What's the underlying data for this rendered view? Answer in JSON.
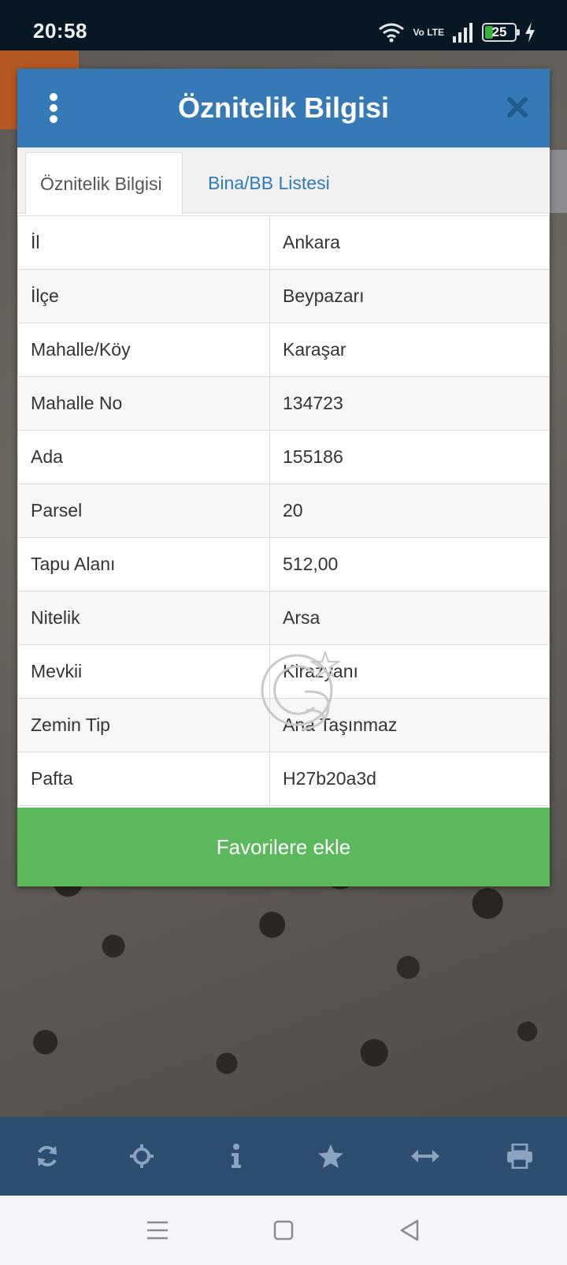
{
  "status_bar": {
    "time": "20:58",
    "battery_level": "25",
    "battery_fraction": 0.25,
    "network": "Vo LTE"
  },
  "modal": {
    "title": "Öznitelik Bilgisi",
    "tabs": [
      {
        "label": "Öznitelik Bilgisi",
        "active": true
      },
      {
        "label": "Bina/BB Listesi",
        "active": false
      }
    ],
    "rows": [
      {
        "key": "İl",
        "value": "Ankara"
      },
      {
        "key": "İlçe",
        "value": "Beypazarı"
      },
      {
        "key": "Mahalle/Köy",
        "value": "Karaşar"
      },
      {
        "key": "Mahalle No",
        "value": "134723"
      },
      {
        "key": "Ada",
        "value": "155186"
      },
      {
        "key": "Parsel",
        "value": "20"
      },
      {
        "key": "Tapu Alanı",
        "value": "512,00"
      },
      {
        "key": "Nitelik",
        "value": "Arsa"
      },
      {
        "key": "Mevkii",
        "value": "Kirazyanı"
      },
      {
        "key": "Zemin Tip",
        "value": "Ana Taşınmaz"
      },
      {
        "key": "Pafta",
        "value": "H27b20a3d"
      }
    ],
    "favorite_button": "Favorilere ekle"
  },
  "toolbar": {
    "icons": [
      "refresh-icon",
      "crosshair-icon",
      "info-icon",
      "star-icon",
      "arrows-horizontal-icon",
      "print-icon"
    ]
  },
  "colors": {
    "header": "#357ab7",
    "favorite": "#5cb85c",
    "toolbar": "#2e4e70",
    "toolbar_icon": "#8aa4bf",
    "tab_link": "#2f7bb8"
  }
}
